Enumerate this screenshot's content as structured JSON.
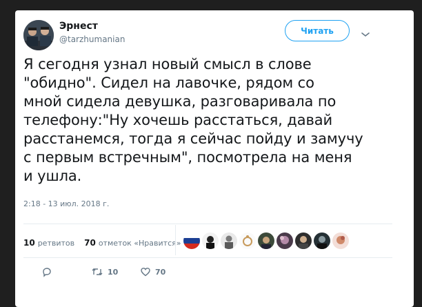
{
  "author": {
    "name": "Эрнест",
    "handle": "@tarzhumanian"
  },
  "follow_label": "Читать",
  "tweet_lines": [
    "Я сегодня узнал новый смысл в слове",
    "\"обидно\". Сидел на лавочке, рядом со",
    "мной сидела девушка, разговаривала по",
    "телефону:\"Ну хочешь расстаться, давай",
    "расстанемся, тогда я сейчас пойду и замучу",
    "с первым встречным\", посмотрела на меня",
    "и ушла."
  ],
  "timestamp": "2:18 - 13 июл. 2018 г.",
  "stats": {
    "retweets_count": "10",
    "retweets_label": "ретвитов",
    "likes_count": "70",
    "likes_label": "отметок «Нравится»"
  },
  "actions": {
    "retweet_count": "10",
    "like_count": "70"
  },
  "colors": {
    "accent": "#1da1f2",
    "muted": "#657786",
    "text": "#14171a",
    "background": "#1f1f1f"
  }
}
